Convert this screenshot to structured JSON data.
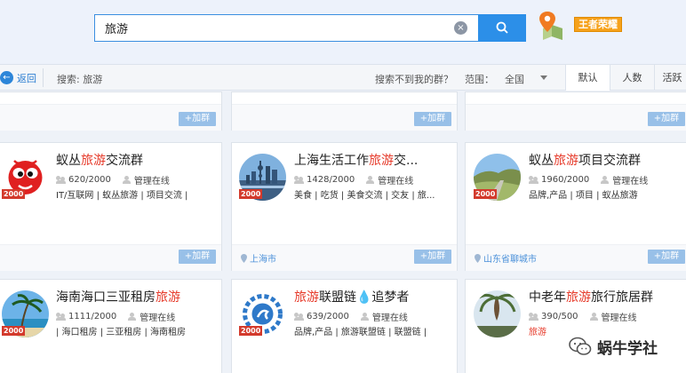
{
  "search": {
    "value": "旅游",
    "clear_label": "×"
  },
  "game_badge": "王者荣耀",
  "filterbar": {
    "back_label": "返回",
    "search_prefix": "搜索: 旅游",
    "not_found": "搜索不到我的群？",
    "range_label": "范围：",
    "range_value": "全国",
    "tabs": [
      "默认",
      "人数",
      "活跃"
    ]
  },
  "join_label": "+加群",
  "cards": [
    {
      "level": "2000",
      "name_pre": "蚁丛",
      "name_hl": "旅游",
      "name_post": "交流群",
      "members": "620/2000",
      "admin": "管理在线",
      "tags": "IT/互联网 | 蚁丛旅游 | 项目交流 |",
      "location": ""
    },
    {
      "level": "2000",
      "name_pre": "上海生活工作",
      "name_hl": "旅游",
      "name_post": "交...",
      "members": "1428/2000",
      "admin": "管理在线",
      "tags": "美食 | 吃货 | 美食交流 | 交友 | 旅...",
      "location": "上海市"
    },
    {
      "level": "2000",
      "name_pre": "蚁丛",
      "name_hl": "旅游",
      "name_post": "项目交流群",
      "members": "1960/2000",
      "admin": "管理在线",
      "tags": "品牌,产品 | 项目 | 蚁丛旅游",
      "location": "山东省聊城市"
    },
    {
      "level": "2000",
      "name_pre": "海南海口三亚租房",
      "name_hl": "旅游",
      "name_post": "",
      "members": "1111/2000",
      "admin": "管理在线",
      "tags": "| 海口租房 | 三亚租房 | 海南租房",
      "location": ""
    },
    {
      "level": "2000",
      "name_pre": "",
      "name_hl": "旅游",
      "name_post": "联盟链💧追梦者",
      "members": "639/2000",
      "admin": "管理在线",
      "tags": "品牌,产品 | 旅游联盟链 | 联盟链 |",
      "location": ""
    },
    {
      "level": "",
      "name_pre": "中老年",
      "name_hl": "旅游",
      "name_post": "旅行旅居群",
      "members": "390/500",
      "admin": "管理在线",
      "tags": "旅游",
      "location": ""
    }
  ],
  "location_second_row": "上海市",
  "watermark": "蜗牛学社",
  "colors": {
    "accent": "#2c8fe8",
    "highlight": "#e63a2a",
    "join": "#98c0e8",
    "level": "#d33a2c"
  }
}
